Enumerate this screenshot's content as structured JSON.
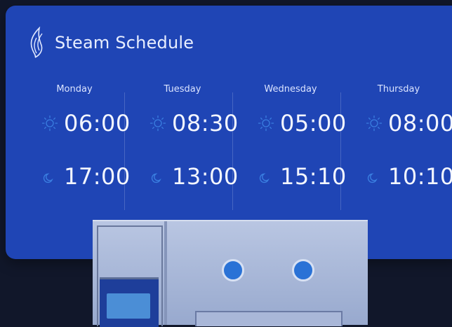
{
  "header": {
    "title": "Steam Schedule",
    "logo_icon": "flame-icon"
  },
  "schedule": [
    {
      "day": "Monday",
      "morning": "06:00",
      "evening": "17:00"
    },
    {
      "day": "Tuesday",
      "morning": "08:30",
      "evening": "13:00"
    },
    {
      "day": "Wednesday",
      "morning": "05:00",
      "evening": "15:10"
    },
    {
      "day": "Thursday",
      "morning": "08:00",
      "evening": "10:10"
    }
  ],
  "icons": {
    "morning": "sun-icon",
    "evening": "moon-icon"
  },
  "colors": {
    "card": "#1f45b5",
    "background": "#11172a",
    "icon": "#3a7ee0",
    "text": "#f3f6ff"
  }
}
